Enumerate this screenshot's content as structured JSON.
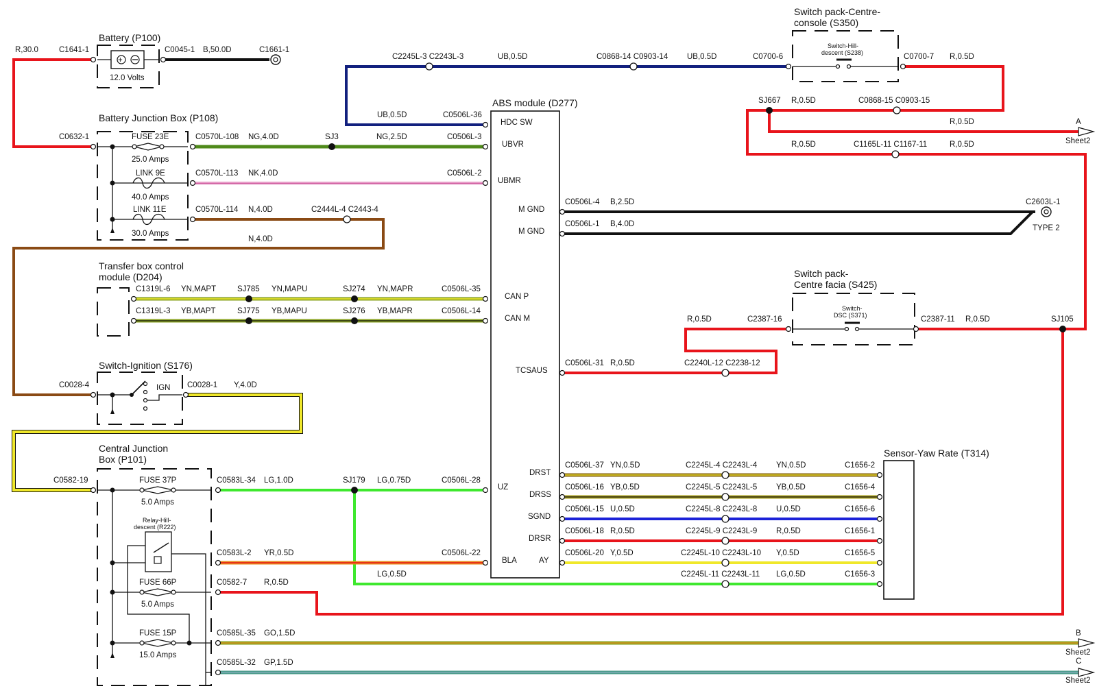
{
  "components": {
    "battery": {
      "title": "Battery (P100)",
      "voltage": "12.0 Volts"
    },
    "bjb": {
      "title": "Battery Junction Box (P108)",
      "fuse23e": "FUSE 23E",
      "fuse23e_amps": "25.0 Amps",
      "link9e": "LINK 9E",
      "link9e_amps": "40.0 Amps",
      "link11e": "LINK 11E",
      "link11e_amps": "30.0 Amps"
    },
    "tbcm": {
      "title1": "Transfer box control",
      "title2": "module (D204)"
    },
    "ign": {
      "title": "Switch-Ignition (S176)",
      "label": "IGN"
    },
    "cjb": {
      "title1": "Central Junction",
      "title2": "Box (P101)",
      "fuse37p": "FUSE 37P",
      "fuse37p_amps": "5.0 Amps",
      "relay1": "Relay-Hill-",
      "relay2": "descent (R222)",
      "fuse66p": "FUSE 66P",
      "fuse66p_amps": "5.0 Amps",
      "fuse15p": "FUSE 15P",
      "fuse15p_amps": "15.0 Amps"
    },
    "abs": {
      "title": "ABS module (D277)",
      "pins": {
        "hdcsw": "HDC SW",
        "ubvr": "UBVR",
        "ubmr": "UBMR",
        "mgnd1": "M GND",
        "mgnd2": "M GND",
        "canp": "CAN P",
        "canm": "CAN M",
        "tcsaus": "TCSAUS",
        "uz": "UZ",
        "drst": "DRST",
        "drss": "DRSS",
        "sgnd": "SGND",
        "drsr": "DRSR",
        "bla": "BLA",
        "ay": "AY"
      }
    },
    "sp350": {
      "title1": "Switch pack-Centre-",
      "title2": "console (S350)",
      "sw1": "Switch-Hill-",
      "sw2": "descent (S238)"
    },
    "sp425": {
      "title1": "Switch pack-",
      "title2": "Centre facia (S425)",
      "sw1": "Switch-",
      "sw2": "DSC (S371)"
    },
    "yaw": {
      "title": "Sensor-Yaw Rate (T314)"
    },
    "ground_type": "TYPE 2"
  },
  "offsheet": {
    "a": {
      "letter": "A",
      "sheet": "Sheet2"
    },
    "b": {
      "letter": "B",
      "sheet": "Sheet2"
    },
    "c": {
      "letter": "C",
      "sheet": "Sheet2"
    }
  },
  "wires": {
    "r300": "R,30.0",
    "b500": "B,50.0D",
    "ng40": "NG,4.0D",
    "ng25": "NG,2.5D",
    "nk40": "NK,4.0D",
    "n40a": "N,4.0D",
    "n40b": "N,4.0D",
    "ub05a": "UB,0.5D",
    "ub05b": "UB,0.5D",
    "ub05c": "UB,0.5D",
    "r05_sp": "R,0.5D",
    "r05_sj667": "R,0.5D",
    "r05_a": "R,0.5D",
    "r05_1165a": "R,0.5D",
    "r05_1165b": "R,0.5D",
    "b25": "B,2.5D",
    "b40": "B,4.0D",
    "yn_mapt": "YN,MAPT",
    "yn_mapu": "YN,MAPU",
    "yn_mapr": "YN,MAPR",
    "yb_mapt": "YB,MAPT",
    "yb_mapu": "YB,MAPU",
    "yb_mapr": "YB,MAPR",
    "r05_2387a": "R,0.5D",
    "r05_2387b": "R,0.5D",
    "r05_tcs": "R,0.5D",
    "y40": "Y,4.0D",
    "lg10": "LG,1.0D",
    "lg075": "LG,0.75D",
    "yr05": "YR,0.5D",
    "lg05a": "LG,0.5D",
    "lg05b": "LG,0.5D",
    "r05_2582": "R,0.5D",
    "go15": "GO,1.5D",
    "gp15": "GP,1.5D",
    "yn05a": "YN,0.5D",
    "yn05b": "YN,0.5D",
    "yb05a": "YB,0.5D",
    "yb05b": "YB,0.5D",
    "u05a": "U,0.5D",
    "u05b": "U,0.5D",
    "r05_d1": "R,0.5D",
    "r05_d2": "R,0.5D",
    "y05a": "Y,0.5D",
    "y05b": "Y,0.5D"
  },
  "connectors": {
    "c1641": "C1641-1",
    "c0045": "C0045-1",
    "c1661": "C1661-1",
    "c0632": "C0632-1",
    "c0570_108": "C0570L-108",
    "c0570_113": "C0570L-113",
    "c0570_114": "C0570L-114",
    "c2444": "C2444L-4 C2443-4",
    "c0506_36": "C0506L-36",
    "c0506_3": "C0506L-3",
    "c0506_2": "C0506L-2",
    "c0506_4": "C0506L-4",
    "c0506_1": "C0506L-1",
    "c0506_35": "C0506L-35",
    "c0506_14": "C0506L-14",
    "c0506_31": "C0506L-31",
    "c0506_28": "C0506L-28",
    "c0506_22": "C0506L-22",
    "c0506_37": "C0506L-37",
    "c0506_16": "C0506L-16",
    "c0506_15": "C0506L-15",
    "c0506_18": "C0506L-18",
    "c0506_20": "C0506L-20",
    "c2245_3": "C2245L-3 C2243L-3",
    "c0868_14": "C0868-14 C0903-14",
    "c0700_6": "C0700-6",
    "c0700_7": "C0700-7",
    "c0868_15": "C0868-15 C0903-15",
    "c1165": "C1165L-11 C1167-11",
    "c2603": "C2603L-1",
    "c1319_6": "C1319L-6",
    "c1319_3": "C1319L-3",
    "c2387_16": "C2387-16",
    "c2387_11": "C2387-11",
    "c2240": "C2240L-12 C2238-12",
    "c0028_4": "C0028-4",
    "c0028_1": "C0028-1",
    "c0582_19": "C0582-19",
    "c0583_34": "C0583L-34",
    "c0583_2": "C0583L-2",
    "c0582_7": "C0582-7",
    "c0585_35": "C0585L-35",
    "c0585_32": "C0585L-32",
    "c2245_4": "C2245L-4 C2243L-4",
    "c2245_5": "C2245L-5 C2243L-5",
    "c2245_8": "C2245L-8 C2243L-8",
    "c2245_9": "C2245L-9 C2243L-9",
    "c2245_10": "C2245L-10 C2243L-10",
    "c2245_11": "C2245L-11 C2243L-11",
    "c1656_2": "C1656-2",
    "c1656_4": "C1656-4",
    "c1656_6": "C1656-6",
    "c1656_1": "C1656-1",
    "c1656_5": "C1656-5",
    "c1656_3": "C1656-3"
  },
  "splices": {
    "sj3": "SJ3",
    "sj667": "SJ667",
    "sj785": "SJ785",
    "sj274": "SJ274",
    "sj775": "SJ775",
    "sj276": "SJ276",
    "sj179": "SJ179",
    "sj105": "SJ105"
  },
  "colors": {
    "red": "#e8141b",
    "blue": "#12207e",
    "blue2": "#1c22d8",
    "green": "#4f8a1a",
    "pink": "#d46aa8",
    "brown": "#8a4a14",
    "black": "#111111",
    "yellow": "#f0e82a",
    "lgreen": "#3ee82e",
    "orange": "#e88a1a",
    "olive": "#8aa321",
    "teal": "#4a9a8a"
  }
}
